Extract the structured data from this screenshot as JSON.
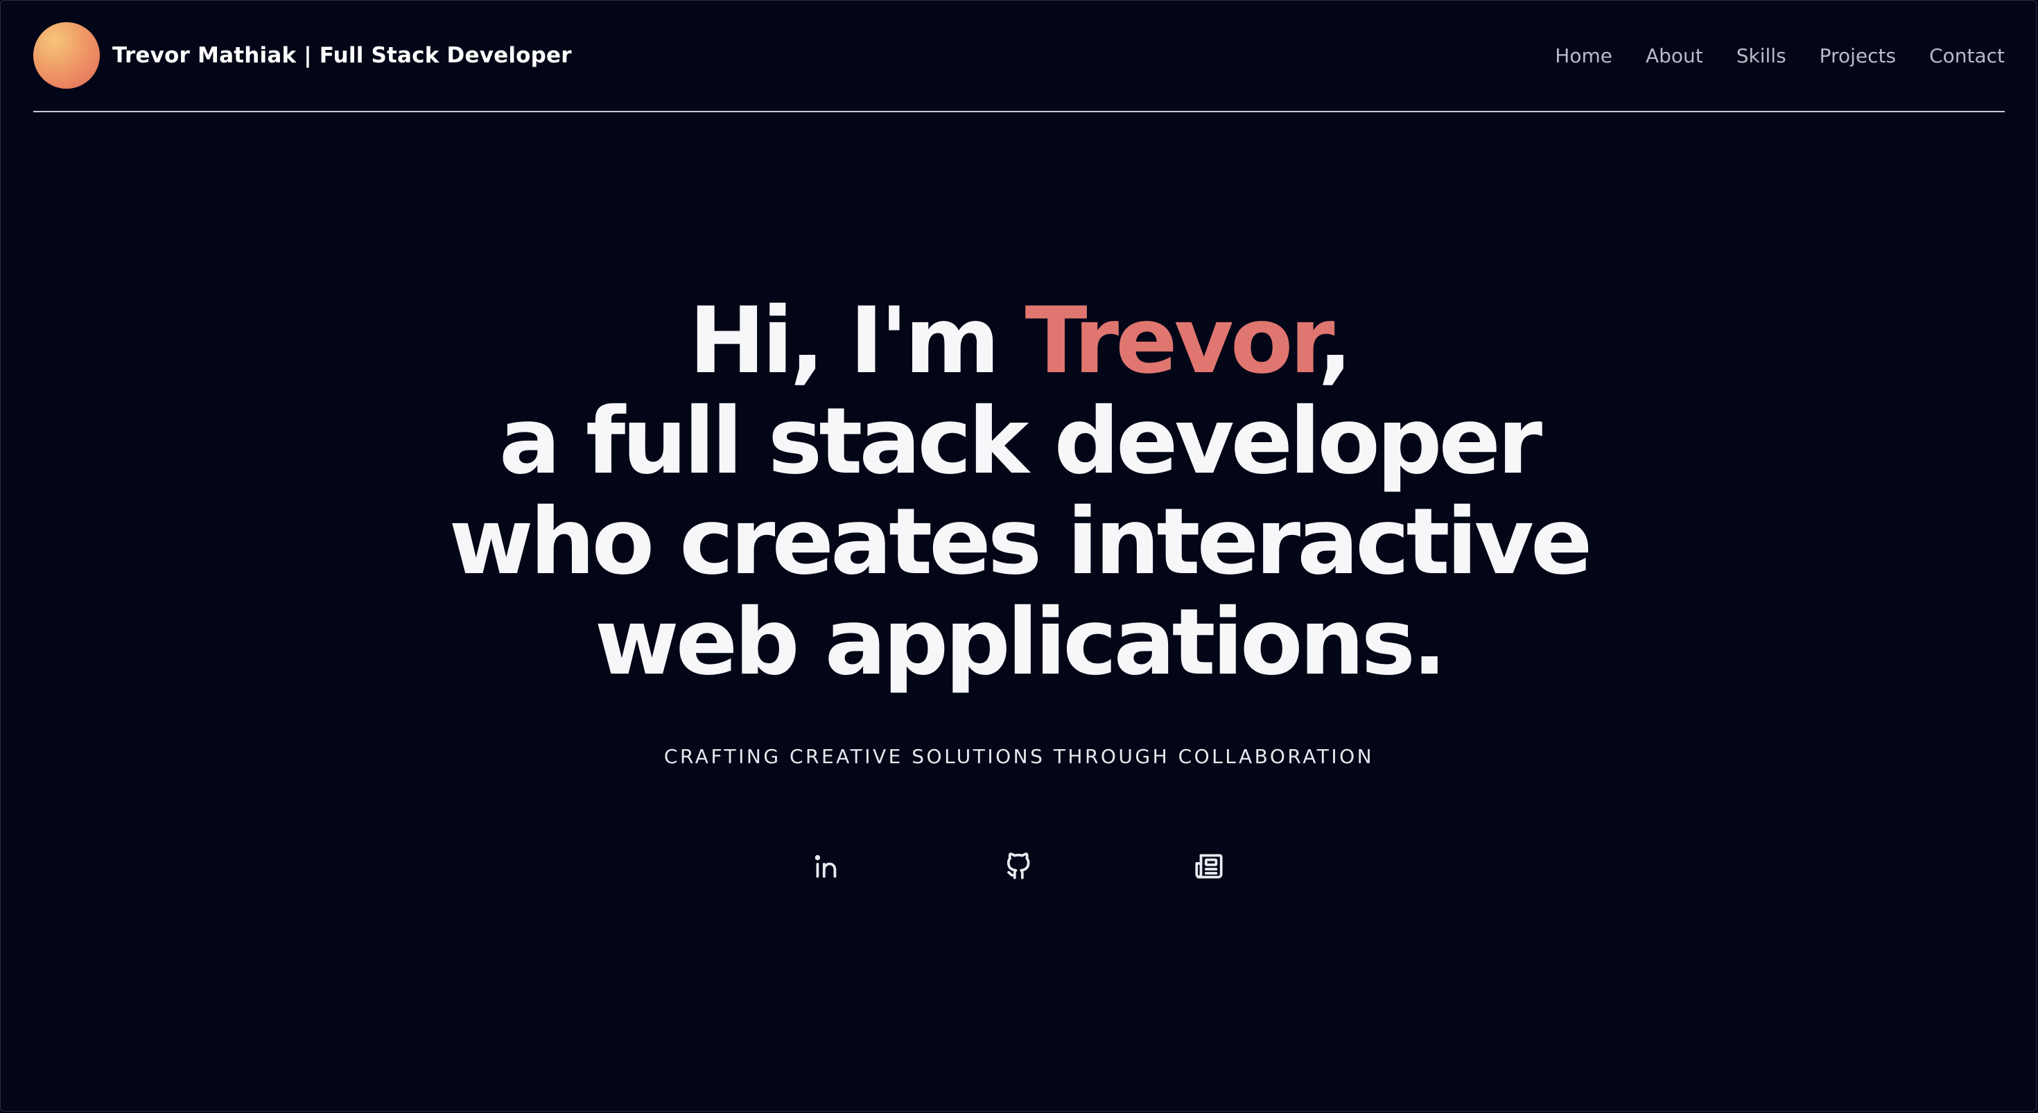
{
  "header": {
    "brand_title": "Trevor Mathiak | Full Stack Developer",
    "nav": [
      {
        "label": "Home"
      },
      {
        "label": "About"
      },
      {
        "label": "Skills"
      },
      {
        "label": "Projects"
      },
      {
        "label": "Contact"
      }
    ]
  },
  "hero": {
    "line1_prefix": "Hi, I'm ",
    "line1_name": "Trevor",
    "line1_suffix": ",",
    "line2": "a full stack developer",
    "line3": "who creates interactive",
    "line4": "web applications.",
    "tagline": "CRAFTING CREATIVE SOLUTIONS THROUGH COLLABORATION"
  },
  "socials": [
    {
      "icon": "linkedin-icon"
    },
    {
      "icon": "github-icon"
    },
    {
      "icon": "newspaper-icon"
    }
  ],
  "colors": {
    "background": "#030617",
    "accent": "#e07670",
    "nav_text": "#b7bcc8",
    "divider": "#c9ccd3"
  }
}
